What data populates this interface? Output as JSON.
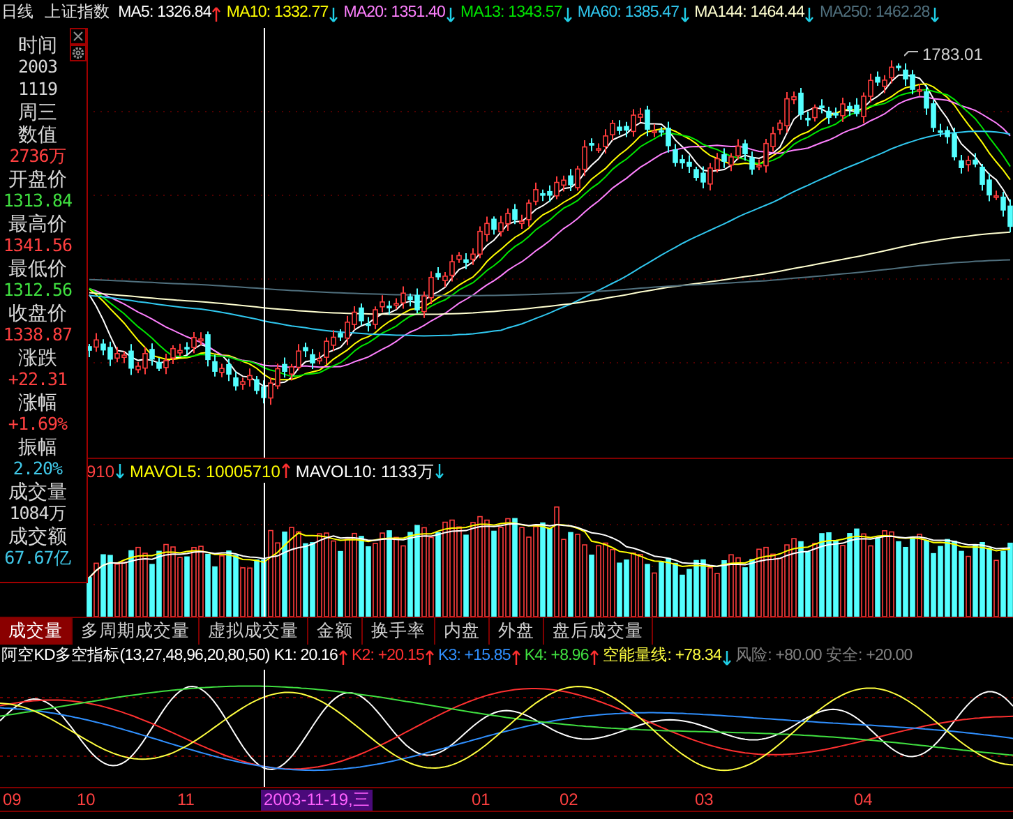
{
  "top_bar": {
    "period": "日线",
    "symbol": "上证指数",
    "indicators": [
      {
        "text": "MA5: 1326.84",
        "color": "#ffffff",
        "rising": true
      },
      {
        "text": "MA10: 1332.77",
        "color": "#ffff00",
        "rising": false
      },
      {
        "text": "MA20: 1351.40",
        "color": "#ff80ff",
        "rising": false
      },
      {
        "text": "MA13: 1343.57",
        "color": "#00e600",
        "rising": false
      },
      {
        "text": "MA60: 1385.47",
        "color": "#30c8f0",
        "rising": false
      },
      {
        "text": "MA144: 1464.44",
        "color": "#ffffd0",
        "rising": false
      },
      {
        "text": "MA250: 1462.28",
        "color": "#50707e",
        "rising": false
      }
    ]
  },
  "info_panel": {
    "lines": [
      {
        "text": "时间",
        "kind": "label",
        "color": "#d8d8d8"
      },
      {
        "text": "2003",
        "kind": "value",
        "color": "#d8d8d8"
      },
      {
        "text": "1119",
        "kind": "value",
        "color": "#d8d8d8"
      },
      {
        "text": "周三",
        "kind": "label",
        "color": "#d8d8d8"
      },
      {
        "text": "数值",
        "kind": "label",
        "color": "#d8d8d8"
      },
      {
        "text": "2736万",
        "kind": "value",
        "color": "#ff4040"
      },
      {
        "text": "开盘价",
        "kind": "label",
        "color": "#d8d8d8"
      },
      {
        "text": "1313.84",
        "kind": "value",
        "color": "#40e040"
      },
      {
        "text": "最高价",
        "kind": "label",
        "color": "#d8d8d8"
      },
      {
        "text": "1341.56",
        "kind": "value",
        "color": "#ff4040"
      },
      {
        "text": "最低价",
        "kind": "label",
        "color": "#d8d8d8"
      },
      {
        "text": "1312.56",
        "kind": "value",
        "color": "#40e040"
      },
      {
        "text": "收盘价",
        "kind": "label",
        "color": "#d8d8d8"
      },
      {
        "text": "1338.87",
        "kind": "value",
        "color": "#ff4040"
      },
      {
        "text": "涨跌",
        "kind": "label",
        "color": "#d8d8d8"
      },
      {
        "text": "+22.31",
        "kind": "value",
        "color": "#ff4040"
      },
      {
        "text": "涨幅",
        "kind": "label",
        "color": "#d8d8d8"
      },
      {
        "text": "+1.69%",
        "kind": "value",
        "color": "#ff4040"
      },
      {
        "text": "振幅",
        "kind": "label",
        "color": "#d8d8d8"
      },
      {
        "text": "2.20%",
        "kind": "value",
        "color": "#40c8e8"
      },
      {
        "text": "成交量",
        "kind": "label",
        "color": "#d8d8d8"
      },
      {
        "text": "1084万",
        "kind": "value",
        "color": "#d8d8d8"
      },
      {
        "text": "成交额",
        "kind": "label",
        "color": "#d8d8d8"
      },
      {
        "text": "67.67亿",
        "kind": "value",
        "color": "#40c8e8"
      }
    ]
  },
  "main_chart": {
    "high_label": "1783.01"
  },
  "volume_header": {
    "items": [
      {
        "text": "910",
        "color": "#ff4040",
        "rising": false
      },
      {
        "text": "MAVOL5: 10005710",
        "color": "#ffff00",
        "rising": true
      },
      {
        "text": "MAVOL10: 1133万",
        "color": "#ffffff",
        "rising": false
      }
    ]
  },
  "tabs": [
    {
      "label": "成交量",
      "selected": true
    },
    {
      "label": "多周期成交量",
      "selected": false
    },
    {
      "label": "虚拟成交量",
      "selected": false
    },
    {
      "label": "金额",
      "selected": false
    },
    {
      "label": "换手率",
      "selected": false
    },
    {
      "label": "内盘",
      "selected": false
    },
    {
      "label": "外盘",
      "selected": false
    },
    {
      "label": "盘后成交量",
      "selected": false
    }
  ],
  "indicator_header": {
    "title": "阿空KD多空指标(13,27,48,96,20,80,50)",
    "items": [
      {
        "text": "K1: 20.16",
        "color": "#ffffff",
        "rising": true
      },
      {
        "text": "K2: +20.15",
        "color": "#ff3030",
        "rising": true
      },
      {
        "text": "K3: +15.85",
        "color": "#3090ff",
        "rising": true
      },
      {
        "text": "K4: +8.96",
        "color": "#40e040",
        "rising": true
      },
      {
        "text": "空能量线: +78.34",
        "color": "#ffff40",
        "rising": false
      },
      {
        "text": "风险: +80.00",
        "color": "#808080"
      },
      {
        "text": "安全: +20.00",
        "color": "#808080"
      }
    ]
  },
  "x_axis": {
    "labels": [
      {
        "text": "09",
        "selected": false
      },
      {
        "text": "10",
        "selected": false
      },
      {
        "text": "11",
        "selected": false
      },
      {
        "text": "2003-11-19,三",
        "selected": true
      },
      {
        "text": "01",
        "selected": false
      },
      {
        "text": "02",
        "selected": false
      },
      {
        "text": "03",
        "selected": false
      },
      {
        "text": "04",
        "selected": false
      }
    ]
  }
}
